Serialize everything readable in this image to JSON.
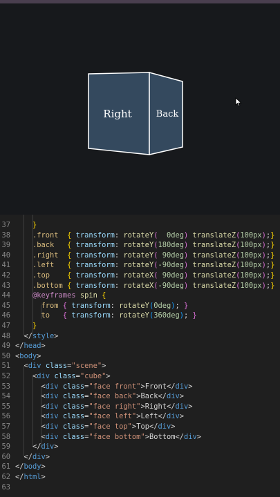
{
  "preview": {
    "front_label": "Right",
    "side_label": "Back"
  },
  "editor": {
    "lines": [
      {
        "n": "37",
        "indent": 4,
        "segs": [
          [
            "br1",
            "}"
          ]
        ]
      },
      {
        "n": "38",
        "indent": 4,
        "segs": [
          [
            "sel",
            ".front"
          ],
          [
            "p",
            "  "
          ],
          [
            "br1",
            "{ "
          ],
          [
            "at",
            "transform"
          ],
          [
            "p",
            ": "
          ],
          [
            "fn",
            "rotateY"
          ],
          [
            "br2",
            "("
          ],
          [
            "num",
            "  0deg"
          ],
          [
            "br2",
            ")"
          ],
          [
            "p",
            " "
          ],
          [
            "fn",
            "translateZ"
          ],
          [
            "br2",
            "("
          ],
          [
            "num",
            "100px"
          ],
          [
            "br2",
            ")"
          ],
          [
            "p",
            ";"
          ],
          [
            "br1",
            "}"
          ]
        ]
      },
      {
        "n": "39",
        "indent": 4,
        "segs": [
          [
            "sel",
            ".back"
          ],
          [
            "p",
            "   "
          ],
          [
            "br1",
            "{ "
          ],
          [
            "at",
            "transform"
          ],
          [
            "p",
            ": "
          ],
          [
            "fn",
            "rotateY"
          ],
          [
            "br2",
            "("
          ],
          [
            "num",
            "180deg"
          ],
          [
            "br2",
            ")"
          ],
          [
            "p",
            " "
          ],
          [
            "fn",
            "translateZ"
          ],
          [
            "br2",
            "("
          ],
          [
            "num",
            "100px"
          ],
          [
            "br2",
            ")"
          ],
          [
            "p",
            ";"
          ],
          [
            "br1",
            "}"
          ]
        ]
      },
      {
        "n": "40",
        "indent": 4,
        "segs": [
          [
            "sel",
            ".right"
          ],
          [
            "p",
            "  "
          ],
          [
            "br1",
            "{ "
          ],
          [
            "at",
            "transform"
          ],
          [
            "p",
            ": "
          ],
          [
            "fn",
            "rotateY"
          ],
          [
            "br2",
            "("
          ],
          [
            "num",
            " 90deg"
          ],
          [
            "br2",
            ")"
          ],
          [
            "p",
            " "
          ],
          [
            "fn",
            "translateZ"
          ],
          [
            "br2",
            "("
          ],
          [
            "num",
            "100px"
          ],
          [
            "br2",
            ")"
          ],
          [
            "p",
            ";"
          ],
          [
            "br1",
            "}"
          ]
        ]
      },
      {
        "n": "41",
        "indent": 4,
        "segs": [
          [
            "sel",
            ".left"
          ],
          [
            "p",
            "   "
          ],
          [
            "br1",
            "{ "
          ],
          [
            "at",
            "transform"
          ],
          [
            "p",
            ": "
          ],
          [
            "fn",
            "rotateY"
          ],
          [
            "br2",
            "("
          ],
          [
            "num",
            "-90deg"
          ],
          [
            "br2",
            ")"
          ],
          [
            "p",
            " "
          ],
          [
            "fn",
            "translateZ"
          ],
          [
            "br2",
            "("
          ],
          [
            "num",
            "100px"
          ],
          [
            "br2",
            ")"
          ],
          [
            "p",
            ";"
          ],
          [
            "br1",
            "}"
          ]
        ]
      },
      {
        "n": "42",
        "indent": 4,
        "segs": [
          [
            "sel",
            ".top"
          ],
          [
            "p",
            "    "
          ],
          [
            "br1",
            "{ "
          ],
          [
            "at",
            "transform"
          ],
          [
            "p",
            ": "
          ],
          [
            "fn",
            "rotateX"
          ],
          [
            "br2",
            "("
          ],
          [
            "num",
            " 90deg"
          ],
          [
            "br2",
            ")"
          ],
          [
            "p",
            " "
          ],
          [
            "fn",
            "translateZ"
          ],
          [
            "br2",
            "("
          ],
          [
            "num",
            "100px"
          ],
          [
            "br2",
            ")"
          ],
          [
            "p",
            ";"
          ],
          [
            "br1",
            "}"
          ]
        ]
      },
      {
        "n": "43",
        "indent": 4,
        "segs": [
          [
            "sel",
            ".bottom"
          ],
          [
            "p",
            " "
          ],
          [
            "br1",
            "{ "
          ],
          [
            "at",
            "transform"
          ],
          [
            "p",
            ": "
          ],
          [
            "fn",
            "rotateX"
          ],
          [
            "br2",
            "("
          ],
          [
            "num",
            "-90deg"
          ],
          [
            "br2",
            ")"
          ],
          [
            "p",
            " "
          ],
          [
            "fn",
            "translateZ"
          ],
          [
            "br2",
            "("
          ],
          [
            "num",
            "100px"
          ],
          [
            "br2",
            ")"
          ],
          [
            "p",
            ";"
          ],
          [
            "br1",
            "}"
          ]
        ]
      },
      {
        "n": "44",
        "indent": 4,
        "segs": [
          [
            "kw",
            "@keyframes"
          ],
          [
            "p",
            " "
          ],
          [
            "fn",
            "spin"
          ],
          [
            "p",
            " "
          ],
          [
            "br1",
            "{"
          ]
        ]
      },
      {
        "n": "45",
        "indent": 6,
        "segs": [
          [
            "sel",
            "from"
          ],
          [
            "p",
            " "
          ],
          [
            "br2",
            "{ "
          ],
          [
            "at",
            "transform"
          ],
          [
            "p",
            ": "
          ],
          [
            "fn",
            "rotateY"
          ],
          [
            "br3",
            "("
          ],
          [
            "num",
            "0deg"
          ],
          [
            "br3",
            ")"
          ],
          [
            "p",
            "; "
          ],
          [
            "br2",
            "}"
          ]
        ]
      },
      {
        "n": "46",
        "indent": 6,
        "segs": [
          [
            "sel",
            "to"
          ],
          [
            "p",
            "   "
          ],
          [
            "br2",
            "{ "
          ],
          [
            "at",
            "transform"
          ],
          [
            "p",
            ": "
          ],
          [
            "fn",
            "rotateY"
          ],
          [
            "br3",
            "("
          ],
          [
            "num",
            "360deg"
          ],
          [
            "br3",
            ")"
          ],
          [
            "p",
            "; "
          ],
          [
            "br2",
            "}"
          ]
        ]
      },
      {
        "n": "47",
        "indent": 4,
        "segs": [
          [
            "br1",
            "}"
          ]
        ]
      },
      {
        "n": "48",
        "indent": 2,
        "segs": [
          [
            "p",
            "</"
          ],
          [
            "tag",
            "style"
          ],
          [
            "p",
            ">"
          ]
        ]
      },
      {
        "n": "49",
        "indent": 0,
        "segs": [
          [
            "p",
            "</"
          ],
          [
            "tag",
            "head"
          ],
          [
            "p",
            ">"
          ]
        ]
      },
      {
        "n": "50",
        "indent": 0,
        "segs": [
          [
            "p",
            "<"
          ],
          [
            "tag",
            "body"
          ],
          [
            "p",
            ">"
          ]
        ]
      },
      {
        "n": "51",
        "indent": 2,
        "segs": [
          [
            "p",
            "<"
          ],
          [
            "tag",
            "div"
          ],
          [
            "p",
            " "
          ],
          [
            "at",
            "class"
          ],
          [
            "p",
            "="
          ],
          [
            "str",
            "\"scene\""
          ],
          [
            "p",
            ">"
          ]
        ]
      },
      {
        "n": "52",
        "indent": 4,
        "segs": [
          [
            "p",
            "<"
          ],
          [
            "tag",
            "div"
          ],
          [
            "p",
            " "
          ],
          [
            "at",
            "class"
          ],
          [
            "p",
            "="
          ],
          [
            "str",
            "\"cube\""
          ],
          [
            "p",
            ">"
          ]
        ]
      },
      {
        "n": "53",
        "indent": 6,
        "segs": [
          [
            "p",
            "<"
          ],
          [
            "tag",
            "div"
          ],
          [
            "p",
            " "
          ],
          [
            "at",
            "class"
          ],
          [
            "p",
            "="
          ],
          [
            "str",
            "\"face front\""
          ],
          [
            "p",
            ">"
          ],
          [
            "txt",
            "Front"
          ],
          [
            "p",
            "</"
          ],
          [
            "tag",
            "div"
          ],
          [
            "p",
            ">"
          ]
        ]
      },
      {
        "n": "54",
        "indent": 6,
        "segs": [
          [
            "p",
            "<"
          ],
          [
            "tag",
            "div"
          ],
          [
            "p",
            " "
          ],
          [
            "at",
            "class"
          ],
          [
            "p",
            "="
          ],
          [
            "str",
            "\"face back\""
          ],
          [
            "p",
            ">"
          ],
          [
            "txt",
            "Back"
          ],
          [
            "p",
            "</"
          ],
          [
            "tag",
            "div"
          ],
          [
            "p",
            ">"
          ]
        ]
      },
      {
        "n": "55",
        "indent": 6,
        "segs": [
          [
            "p",
            "<"
          ],
          [
            "tag",
            "div"
          ],
          [
            "p",
            " "
          ],
          [
            "at",
            "class"
          ],
          [
            "p",
            "="
          ],
          [
            "str",
            "\"face right\""
          ],
          [
            "p",
            ">"
          ],
          [
            "txt",
            "Right"
          ],
          [
            "p",
            "</"
          ],
          [
            "tag",
            "div"
          ],
          [
            "p",
            ">"
          ]
        ]
      },
      {
        "n": "56",
        "indent": 6,
        "segs": [
          [
            "p",
            "<"
          ],
          [
            "tag",
            "div"
          ],
          [
            "p",
            " "
          ],
          [
            "at",
            "class"
          ],
          [
            "p",
            "="
          ],
          [
            "str",
            "\"face left\""
          ],
          [
            "p",
            ">"
          ],
          [
            "txt",
            "Left"
          ],
          [
            "p",
            "</"
          ],
          [
            "tag",
            "div"
          ],
          [
            "p",
            ">"
          ]
        ]
      },
      {
        "n": "57",
        "indent": 6,
        "segs": [
          [
            "p",
            "<"
          ],
          [
            "tag",
            "div"
          ],
          [
            "p",
            " "
          ],
          [
            "at",
            "class"
          ],
          [
            "p",
            "="
          ],
          [
            "str",
            "\"face top\""
          ],
          [
            "p",
            ">"
          ],
          [
            "txt",
            "Top"
          ],
          [
            "p",
            "</"
          ],
          [
            "tag",
            "div"
          ],
          [
            "p",
            ">"
          ]
        ]
      },
      {
        "n": "58",
        "indent": 6,
        "segs": [
          [
            "p",
            "<"
          ],
          [
            "tag",
            "div"
          ],
          [
            "p",
            " "
          ],
          [
            "at",
            "class"
          ],
          [
            "p",
            "="
          ],
          [
            "str",
            "\"face bottom\""
          ],
          [
            "p",
            ">"
          ],
          [
            "txt",
            "Bottom"
          ],
          [
            "p",
            "</"
          ],
          [
            "tag",
            "div"
          ],
          [
            "p",
            ">"
          ]
        ]
      },
      {
        "n": "59",
        "indent": 4,
        "segs": [
          [
            "p",
            "</"
          ],
          [
            "tag",
            "div"
          ],
          [
            "p",
            ">"
          ]
        ]
      },
      {
        "n": "60",
        "indent": 2,
        "segs": [
          [
            "p",
            "</"
          ],
          [
            "tag",
            "div"
          ],
          [
            "p",
            ">"
          ]
        ]
      },
      {
        "n": "61",
        "indent": 0,
        "segs": [
          [
            "p",
            "</"
          ],
          [
            "tag",
            "body"
          ],
          [
            "p",
            ">"
          ]
        ]
      },
      {
        "n": "62",
        "indent": 0,
        "segs": [
          [
            "p",
            "</"
          ],
          [
            "tag",
            "html"
          ],
          [
            "p",
            ">"
          ]
        ]
      },
      {
        "n": "63",
        "indent": 0,
        "segs": []
      }
    ]
  }
}
